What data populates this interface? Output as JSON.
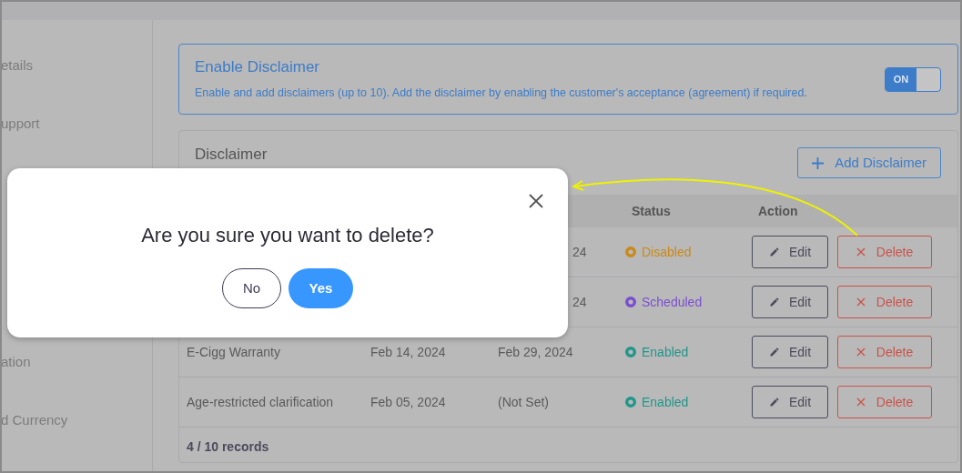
{
  "sidebar": {
    "items": [
      {
        "label": "etails"
      },
      {
        "label": "upport"
      },
      {
        "label": "ation"
      },
      {
        "label": "d Currency"
      }
    ]
  },
  "enable_card": {
    "title": "Enable Disclaimer",
    "description": "Enable and add disclaimers (up to 10). Add the disclaimer by enabling the customer's acceptance (agreement) if required.",
    "toggle": {
      "label": "ON",
      "on": true
    }
  },
  "disclaimer_card": {
    "title": "Disclaimer",
    "add_button": "Add Disclaimer",
    "table": {
      "columns": [
        "Status",
        "Action"
      ],
      "rows": [
        {
          "end": "24",
          "status": "Disabled",
          "color": "#c98a1a",
          "edit_label": "Edit",
          "delete_label": "Delete"
        },
        {
          "end": "24",
          "status": "Scheduled",
          "color": "#7a4fcf",
          "edit_label": "Edit",
          "delete_label": "Delete"
        },
        {
          "name": "E-Cigg Warranty",
          "start": "Feb 14, 2024",
          "end": "Feb 29, 2024",
          "status": "Enabled",
          "color": "#21968a",
          "edit_label": "Edit",
          "delete_label": "Delete"
        },
        {
          "name": "Age-restricted clarification",
          "start": "Feb 05, 2024",
          "end": "(Not Set)",
          "status": "Enabled",
          "color": "#21968a",
          "edit_label": "Edit",
          "delete_label": "Delete"
        }
      ]
    },
    "footer": "4 / 10 records"
  },
  "dialog": {
    "question": "Are you sure you want to delete?",
    "buttons": [
      {
        "label": "No",
        "kind": "secondary"
      },
      {
        "label": "Yes",
        "kind": "primary"
      }
    ]
  }
}
